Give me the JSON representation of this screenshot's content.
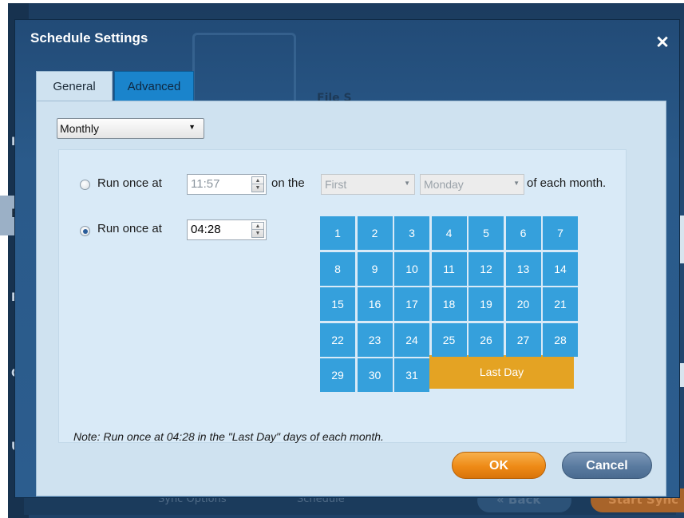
{
  "background": {
    "sidebar": [
      "Ho",
      "Ba",
      "Re",
      "Cl",
      "Ut"
    ],
    "right_text": [
      "e fi",
      "ll t",
      "De"
    ],
    "bottom": {
      "sync_options": "Sync Options",
      "schedule": "Schedule",
      "back": "« Back",
      "start_sync": "Start Sync"
    },
    "ghost_title": "File S"
  },
  "dialog": {
    "title": "Schedule Settings",
    "close": "✕",
    "tabs": {
      "general": "General",
      "advanced": "Advanced"
    },
    "frequency": {
      "value": "Monthly"
    },
    "option1": {
      "label": "Run once at",
      "time": "11:57",
      "on_the": "on the",
      "week_select": "First",
      "day_select": "Monday",
      "suffix": "of each month."
    },
    "option2": {
      "label": "Run once at",
      "time": "04:28"
    },
    "calendar": {
      "days": [
        "1",
        "2",
        "3",
        "4",
        "5",
        "6",
        "7",
        "8",
        "9",
        "10",
        "11",
        "12",
        "13",
        "14",
        "15",
        "16",
        "17",
        "18",
        "19",
        "20",
        "21",
        "22",
        "23",
        "24",
        "25",
        "26",
        "27",
        "28",
        "29",
        "30",
        "31"
      ],
      "last_day": "Last Day"
    },
    "note": "Note: Run once at 04:28 in the \"Last Day\" days of each month.",
    "buttons": {
      "ok": "OK",
      "cancel": "Cancel"
    }
  },
  "colors": {
    "day_tile": "#35a0dc",
    "last_day_tile": "#e4a323",
    "ok_button": "#ee8a16",
    "cancel_button": "#597a9f"
  }
}
